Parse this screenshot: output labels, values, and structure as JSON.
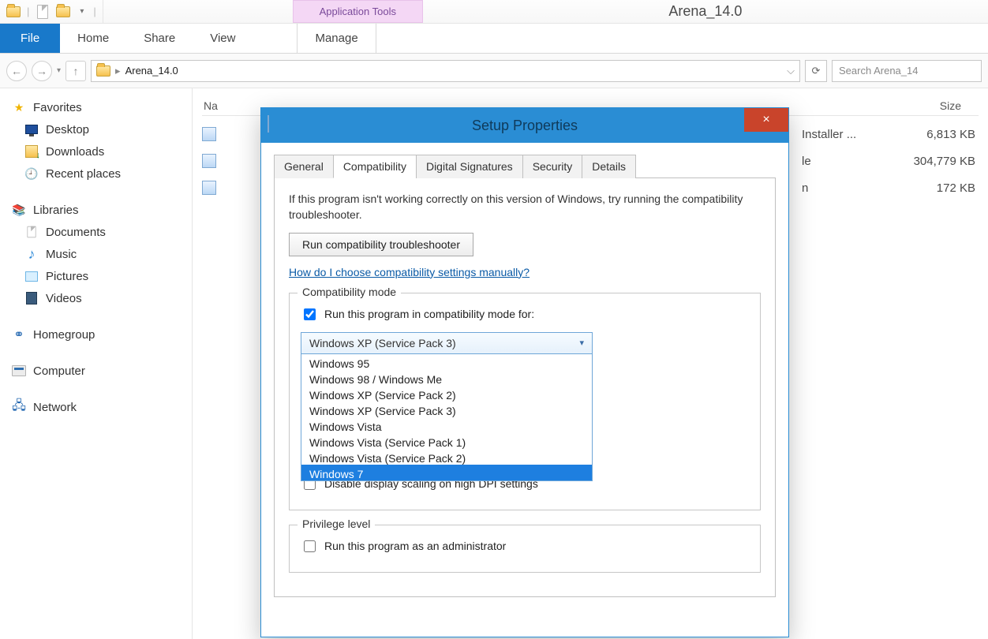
{
  "window": {
    "title": "Arena_14.0",
    "context_tab": "Application Tools"
  },
  "ribbon": {
    "file": "File",
    "home": "Home",
    "share": "Share",
    "view": "View",
    "manage": "Manage"
  },
  "address": {
    "folder": "Arena_14.0",
    "refresh_glyph": "⟳",
    "dropdown_glyph": "⌵",
    "search_placeholder": "Search Arena_14"
  },
  "sidebar": {
    "favorites": "Favorites",
    "desktop": "Desktop",
    "downloads": "Downloads",
    "recent": "Recent places",
    "libraries": "Libraries",
    "documents": "Documents",
    "music": "Music",
    "pictures": "Pictures",
    "videos": "Videos",
    "homegroup": "Homegroup",
    "computer": "Computer",
    "network": "Network"
  },
  "list": {
    "col_name": "Na",
    "col_size": "Size",
    "rows": [
      {
        "type_fragment": "Installer ...",
        "size": "6,813 KB"
      },
      {
        "type_fragment": "le",
        "size": "304,779 KB"
      },
      {
        "type_fragment": "n",
        "size": "172 KB"
      }
    ]
  },
  "dialog": {
    "title": "Setup Properties",
    "close": "×",
    "tabs": {
      "general": "General",
      "compat": "Compatibility",
      "sign": "Digital Signatures",
      "security": "Security",
      "details": "Details"
    },
    "compat": {
      "hint": "If this program isn't working correctly on this version of Windows, try running the compatibility troubleshooter.",
      "run_troubleshooter": "Run compatibility troubleshooter",
      "help_link": "How do I choose compatibility settings manually?",
      "group_mode": "Compatibility mode",
      "chk_run_mode": "Run this program in compatibility mode for:",
      "mode_selected": "Windows XP (Service Pack 3)",
      "mode_options": [
        "Windows 95",
        "Windows 98 / Windows Me",
        "Windows XP (Service Pack 2)",
        "Windows XP (Service Pack 3)",
        "Windows Vista",
        "Windows Vista (Service Pack 1)",
        "Windows Vista (Service Pack 2)",
        "Windows 7"
      ],
      "mode_highlighted": "Windows 7",
      "chk_dpi": "Disable display scaling on high DPI settings",
      "group_priv": "Privilege level",
      "chk_admin": "Run this program as an administrator"
    }
  }
}
